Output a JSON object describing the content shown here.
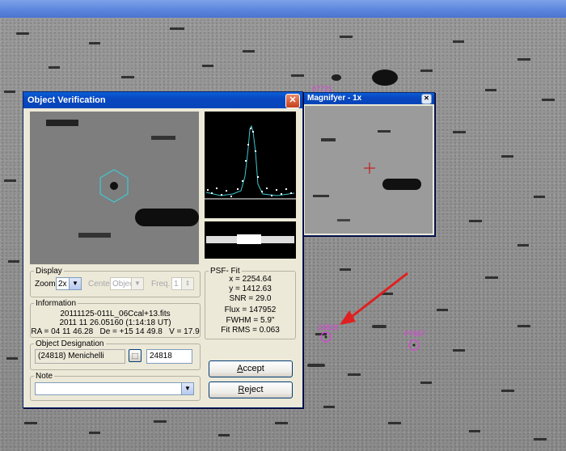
{
  "labels": {
    "top_star": "07721",
    "target": "24818",
    "other_star": "P7857"
  },
  "magnifier": {
    "title": "Magnifyer - 1x"
  },
  "dialog": {
    "title": "Object Verification",
    "display": {
      "legend": "Display",
      "zoom_label": "Zoom",
      "zoom_value": "2x",
      "center_label": "Center",
      "center_value": "Object",
      "freq_label": "Freq.",
      "freq_value": "1"
    },
    "information": {
      "legend": "Information",
      "filename": "20111125-011L_06Ccal+13.fits",
      "datetime": "2011 11 26.05160 (1:14:18 UT)",
      "coords": "RA = 04 11 46.28   De = +15 14 49.8   V = 17.9"
    },
    "designation": {
      "legend": "Object Designation",
      "name": "(24818) Menichelli",
      "number": "24818"
    },
    "note": {
      "legend": "Note",
      "value": ""
    },
    "psf": {
      "legend": "PSF- Fit",
      "x": "x = 2254.64",
      "y": "y = 1412.63",
      "snr": "SNR = 29.0",
      "flux": "Flux = 147952",
      "fwhm": "FWHM = 5.9\"",
      "rms": "Fit RMS = 0.063"
    },
    "buttons": {
      "accept_prefix": "A",
      "accept_rest": "ccept",
      "reject_prefix": "R",
      "reject_rest": "eject"
    }
  },
  "colors": {
    "titlebar": "#0645b8",
    "annotation": "#e040e0",
    "arrow": "#e02020",
    "psf_curve": "#40c8d0"
  }
}
